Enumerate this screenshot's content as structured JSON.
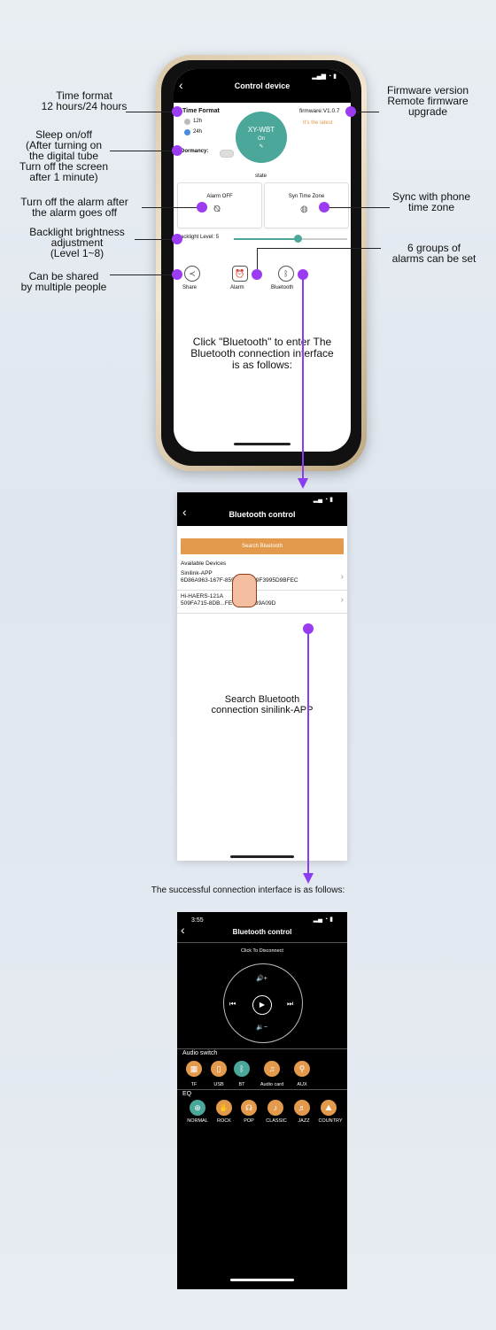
{
  "colors": {
    "accent_teal": "#4aa79a",
    "accent_orange": "#e39a4c",
    "callout_purple": "#9b3cf0"
  },
  "phone1": {
    "title": "Control device",
    "time_format": {
      "label": "Time Format",
      "opt12": "12h",
      "opt24": "24h"
    },
    "device": {
      "name": "XY-WBT",
      "state": "On",
      "icon": "edit-icon"
    },
    "firmware": {
      "label": "firmware:V1.0.7",
      "note": "It's the latest"
    },
    "dormancy": "Dormancy:",
    "state_label": "state",
    "alarm_off": "Alarm OFF",
    "syn_time_zone": "Syn Time Zone",
    "backlight": "Backlight Level: 5",
    "backlight_level": 5,
    "buttons": {
      "share": "Share",
      "alarm": "Alarm",
      "bluetooth": "Bluetooth"
    },
    "info": "Click \"Bluetooth\" to enter The Bluetooth connection interface is as follows:"
  },
  "callouts": {
    "time_format": "Time format\n12 hours/24 hours",
    "sleep": "Sleep on/off\n(After turning on\nthe digital tube\nTurn off the screen\nafter 1 minute)",
    "alarm_off": "Turn off the alarm after\nthe alarm goes off",
    "backlight": "Backlight brightness\nadjustment\n(Level 1~8)",
    "share": "Can be shared\nby multiple people",
    "firmware": "Firmware version\nRemote firmware\nupgrade",
    "sync": "Sync with phone\ntime zone",
    "alarms": "6 groups of\nalarms can be set"
  },
  "screen2": {
    "title": "Bluetooth control",
    "search_button": "Search Bluetooth",
    "available": "Available Devices",
    "devices": [
      {
        "name": "Sinilink-APP",
        "id": "6D86A963-167F-8599-40CE-9F3995D9BFEC"
      },
      {
        "name": "Hi-HAERS-121A",
        "id": "509FA715-8DB...FE-7246D4B9A09D"
      }
    ],
    "caption": "Search Bluetooth\nconnection sinilink-APP"
  },
  "success_caption": "The successful connection interface is as follows:",
  "screen3": {
    "time": "3:55",
    "title": "Bluetooth control",
    "disconnect": "Click To Disconnect",
    "audio_switch": "Audio switch",
    "sources": [
      "TF",
      "USB",
      "BT",
      "Audio card",
      "AUX"
    ],
    "eq": "EQ",
    "eq_modes": [
      "NORMAL",
      "ROCK",
      "POP",
      "CLASSIC",
      "JAZZ",
      "COUNTRY"
    ]
  }
}
